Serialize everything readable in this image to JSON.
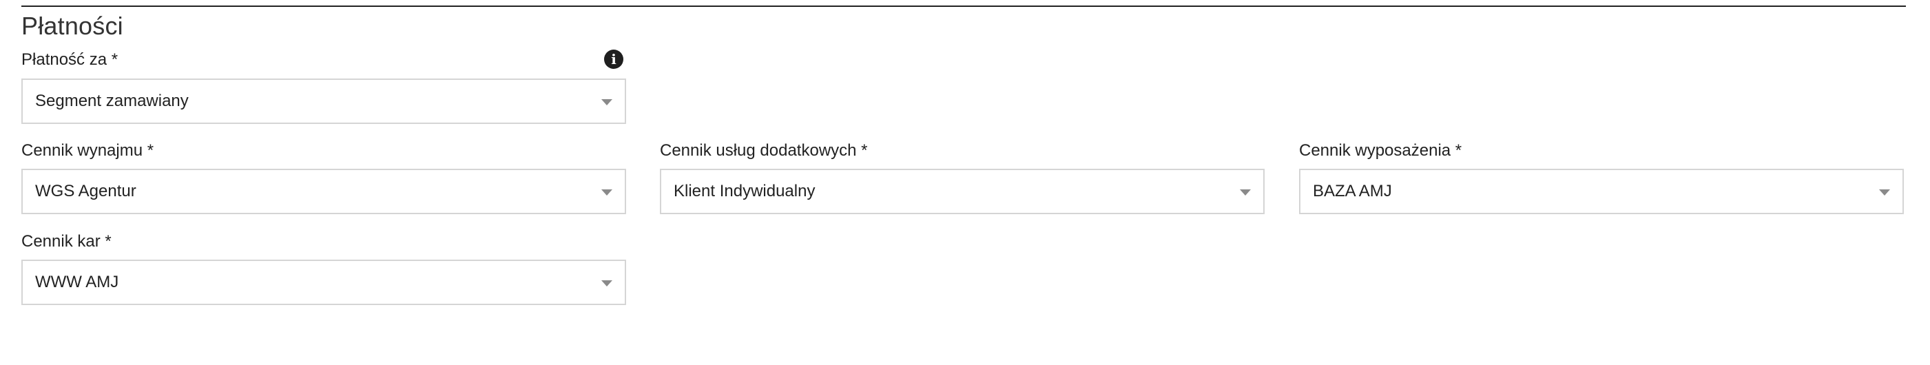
{
  "section": {
    "title": "Płatności"
  },
  "icons": {
    "info": "i"
  },
  "fields": {
    "payment_for": {
      "label": "Płatność za *",
      "value": "Segment zamawiany"
    },
    "rental_pricelist": {
      "label": "Cennik wynajmu *",
      "value": "WGS Agentur"
    },
    "additional_services_pricelist": {
      "label": "Cennik usług dodatkowych *",
      "value": "Klient Indywidualny"
    },
    "equipment_pricelist": {
      "label": "Cennik wyposażenia *",
      "value": "BAZA AMJ"
    },
    "penalties_pricelist": {
      "label": "Cennik kar *",
      "value": "WWW AMJ"
    }
  }
}
